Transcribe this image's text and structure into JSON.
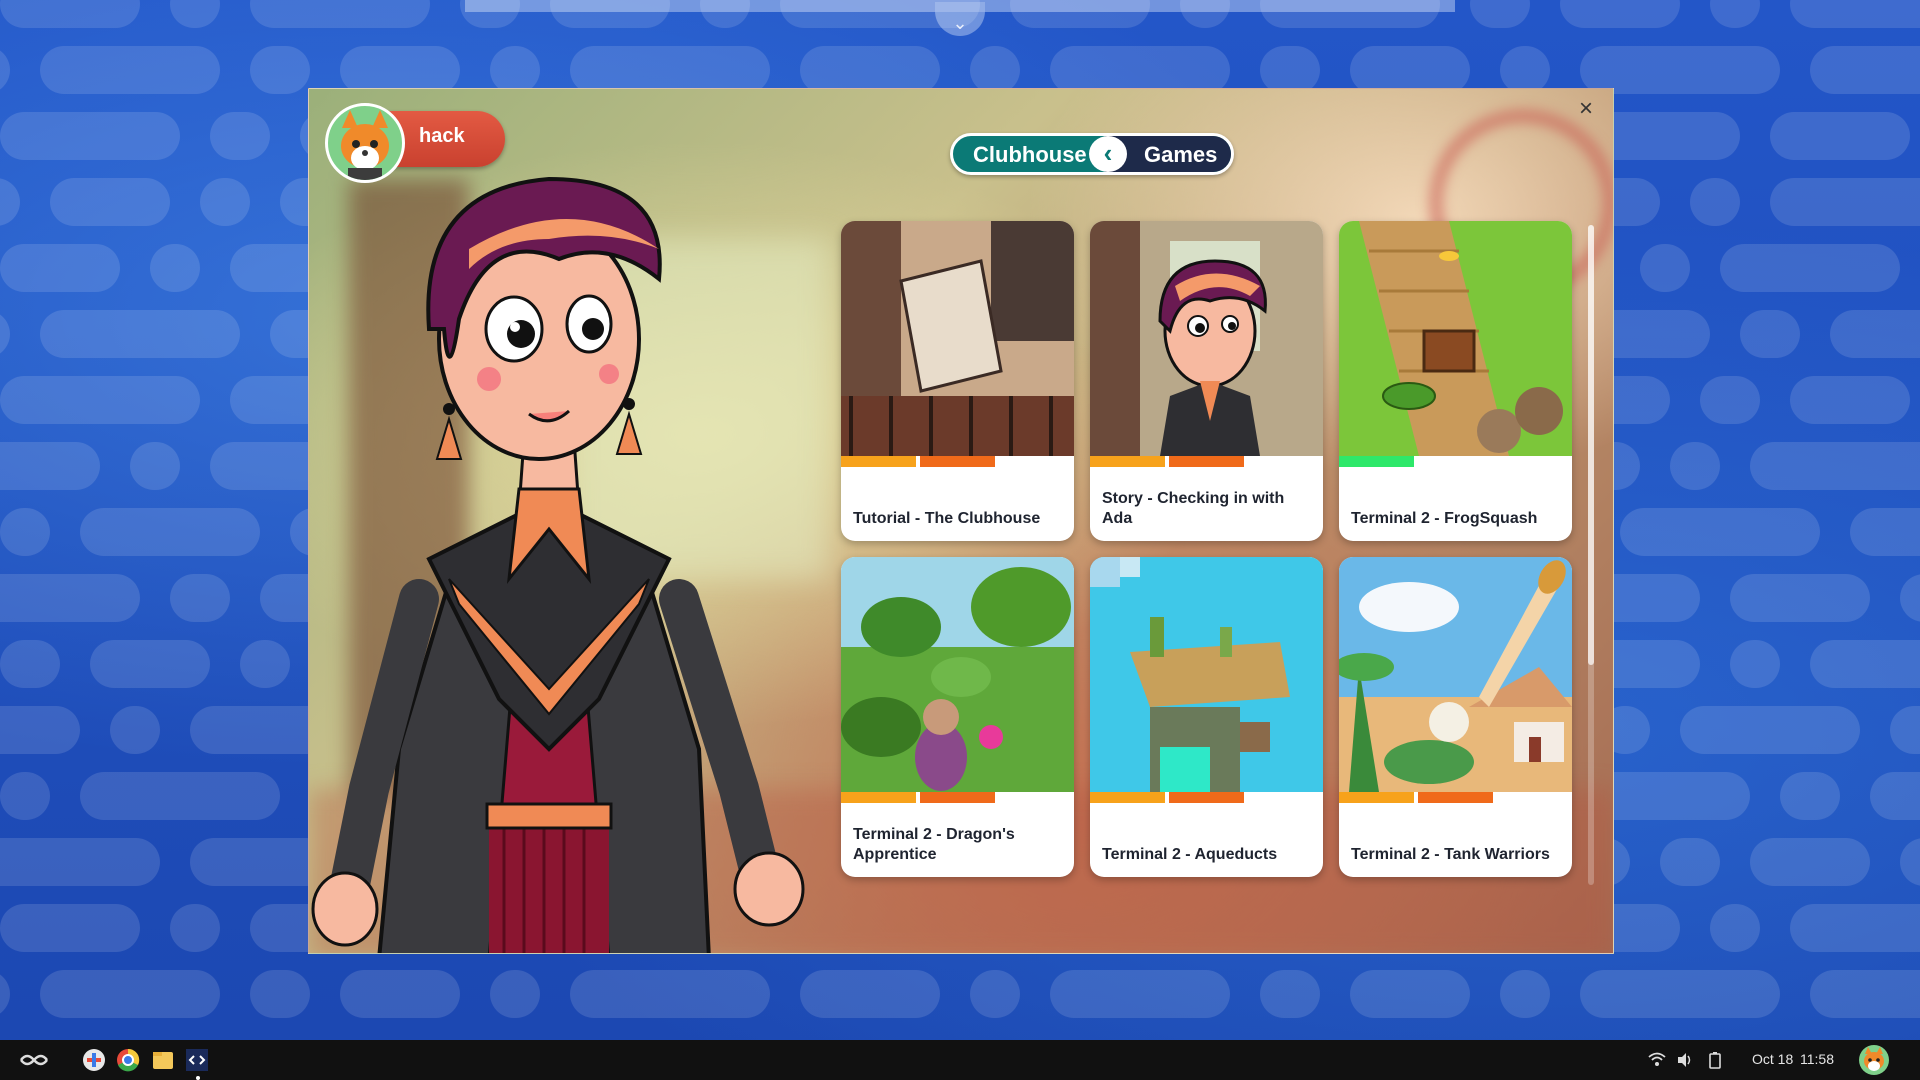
{
  "window": {
    "close_glyph": "×",
    "user": {
      "name": "hack",
      "avatar_icon": "fox-avatar-icon"
    },
    "nav": {
      "left_label": "Clubhouse",
      "right_label": "Games",
      "back_glyph": "‹"
    },
    "games": [
      {
        "title": "Tutorial - The Clubhouse",
        "progress_colors": [
          "#f7a21b",
          "#f06a1a"
        ]
      },
      {
        "title": "Story - Checking in with Ada",
        "progress_colors": [
          "#f7a21b",
          "#f06a1a"
        ]
      },
      {
        "title": "Terminal 2 - FrogSquash",
        "progress_colors": [
          "#2ee86a"
        ]
      },
      {
        "title": "Terminal 2 - Dragon's Apprentice",
        "progress_colors": [
          "#f7a21b",
          "#f06a1a"
        ]
      },
      {
        "title": "Terminal 2 - Aqueducts",
        "progress_colors": [
          "#f7a21b",
          "#f06a1a"
        ]
      },
      {
        "title": "Terminal 2 - Tank Warriors",
        "progress_colors": [
          "#f7a21b",
          "#f06a1a"
        ]
      }
    ]
  },
  "taskbar": {
    "apps": [
      "endless-menu-icon",
      "app-center-icon",
      "chrome-icon",
      "files-icon",
      "hack-terminal-icon"
    ],
    "status_icons": [
      "wifi-icon",
      "volume-icon",
      "battery-icon"
    ],
    "date": "Oct 18",
    "time": "11:58"
  },
  "colors": {
    "teal": "#0b7a76",
    "navy": "#1e2a4a",
    "orange": "#f06a1a",
    "red": "#d94a36"
  }
}
